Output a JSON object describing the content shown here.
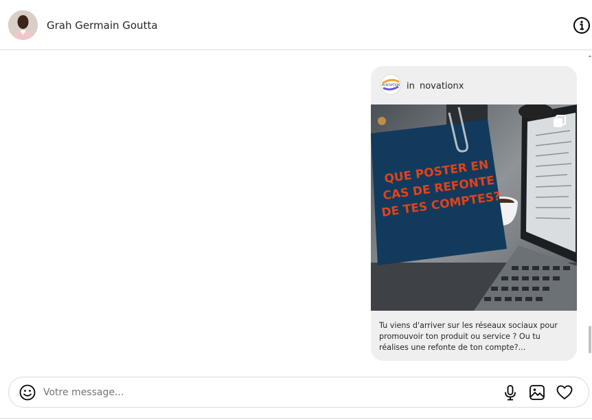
{
  "header": {
    "contact_name": "Grah Germain Goutta"
  },
  "post": {
    "author": "in novationx",
    "logo_text": "IN NOVATION",
    "image_headline": [
      "QUE POSTER EN",
      "CAS DE REFONTE",
      "DE TES COMPTES?"
    ],
    "caption": "Tu viens d'arriver sur les réseaux sociaux pour promouvoir ton produit ou service ? Ou tu réalises une refonte de ton compte?..."
  },
  "composer": {
    "placeholder": "Votre message..."
  },
  "icons": {
    "info": "info-icon",
    "emoji": "emoji-icon",
    "mic": "microphone-icon",
    "photo": "image-icon",
    "heart": "heart-icon",
    "multi": "carousel-icon"
  },
  "colors": {
    "note_blue": "#123a5c",
    "headline_orange": "#e0431b",
    "bubble_bg": "#efefef",
    "border": "#dbdbdb"
  }
}
